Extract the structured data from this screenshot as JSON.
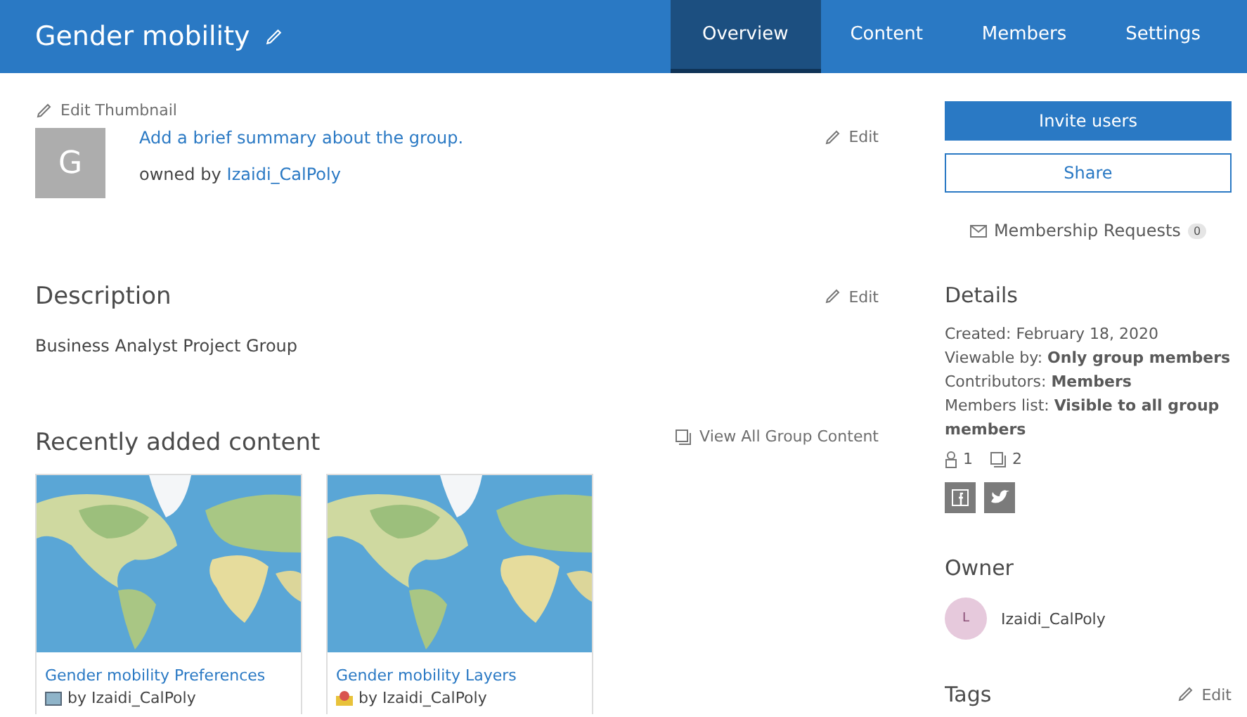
{
  "header": {
    "title": "Gender mobility",
    "tabs": [
      {
        "label": "Overview",
        "selected": true
      },
      {
        "label": "Content",
        "selected": false
      },
      {
        "label": "Members",
        "selected": false
      },
      {
        "label": "Settings",
        "selected": false
      }
    ]
  },
  "summary": {
    "edit_thumbnail": "Edit Thumbnail",
    "thumbnail_letter": "G",
    "text": "Add a brief summary about the group.",
    "owned_by": "owned by",
    "owner": "Izaidi_CalPoly",
    "edit": "Edit"
  },
  "description": {
    "heading": "Description",
    "text": "Business Analyst Project Group",
    "edit": "Edit"
  },
  "recent": {
    "heading": "Recently added content",
    "view_all": "View All Group Content",
    "items": [
      {
        "title": "Gender mobility Preferences",
        "by": "by Izaidi_CalPoly",
        "kind": "map"
      },
      {
        "title": "Gender mobility Layers",
        "by": "by Izaidi_CalPoly",
        "kind": "layer"
      }
    ]
  },
  "sidebar": {
    "invite": "Invite users",
    "share": "Share",
    "requests": "Membership Requests",
    "requests_count": "0",
    "details_heading": "Details",
    "details": [
      "Created: February 18, 2020",
      "Viewable by: **Only group members**",
      "Contributors: **Members**",
      "Members list: **Visible to all group members**"
    ],
    "member_count": "1",
    "content_count": "2",
    "owner_heading": "Owner",
    "owner_initial": "L",
    "owner": "Izaidi_CalPoly",
    "tags_heading": "Tags",
    "tags_edit": "Edit"
  }
}
